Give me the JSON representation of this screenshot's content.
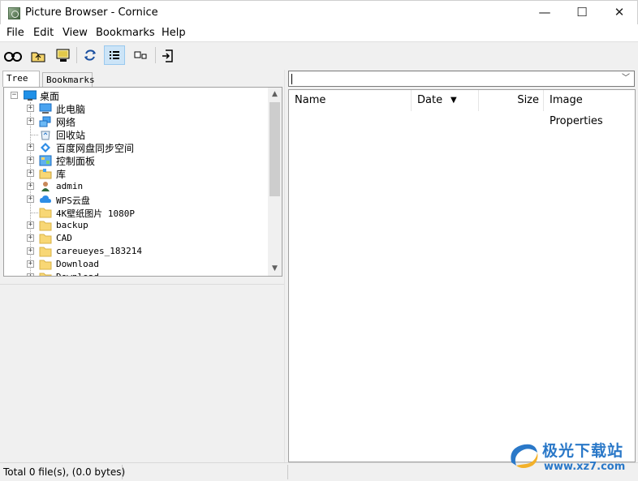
{
  "window": {
    "title": "Picture Browser - Cornice",
    "minimize_glyph": "—",
    "maximize_glyph": "☐",
    "close_glyph": "✕"
  },
  "menu": [
    "File",
    "Edit",
    "View",
    "Bookmarks",
    "Help"
  ],
  "toolbar": {
    "buttons": [
      {
        "icon": "binoculars-icon"
      },
      {
        "icon": "folder-up-icon"
      },
      {
        "icon": "slideshow-monitor-icon"
      },
      {
        "icon": "refresh-icon"
      },
      {
        "icon": "details-view-icon",
        "active": true
      },
      {
        "icon": "thumbnails-view-icon"
      },
      {
        "icon": "exit-icon"
      }
    ]
  },
  "tabs": {
    "tree": "Tree",
    "bookmarks": "Bookmarks"
  },
  "tree": {
    "root": "桌面",
    "items": [
      {
        "label": "此电脑",
        "icon": "computer-icon",
        "expandable": true,
        "mono": false
      },
      {
        "label": "网络",
        "icon": "network-icon",
        "expandable": true,
        "mono": false
      },
      {
        "label": "回收站",
        "icon": "recycle-bin-icon",
        "expandable": false,
        "mono": false
      },
      {
        "label": "百度网盘同步空间",
        "icon": "baidu-sync-icon",
        "expandable": true,
        "mono": false
      },
      {
        "label": "控制面板",
        "icon": "control-panel-icon",
        "expandable": true,
        "mono": false
      },
      {
        "label": "库",
        "icon": "library-folder-icon",
        "expandable": true,
        "mono": false
      },
      {
        "label": "admin",
        "icon": "user-folder-icon",
        "expandable": true,
        "mono": true
      },
      {
        "label": "WPS云盘",
        "icon": "wps-cloud-icon",
        "expandable": true,
        "mono": true
      },
      {
        "label": "4K壁纸图片 1080P",
        "icon": "folder-icon",
        "expandable": false,
        "mono": true
      },
      {
        "label": "backup",
        "icon": "folder-icon",
        "expandable": true,
        "mono": true
      },
      {
        "label": "CAD",
        "icon": "folder-icon",
        "expandable": true,
        "mono": true
      },
      {
        "label": "careueyes_183214",
        "icon": "folder-icon",
        "expandable": true,
        "mono": true
      },
      {
        "label": "Download",
        "icon": "folder-icon",
        "expandable": true,
        "mono": true
      },
      {
        "label": "Download",
        "icon": "folder-icon",
        "expandable": true,
        "mono": true
      }
    ]
  },
  "address": {
    "value": ""
  },
  "filelist": {
    "columns": [
      "Name",
      "Date",
      "Size",
      "Image Properties"
    ],
    "sort_glyph": "▼"
  },
  "status": {
    "text": "Total 0 file(s), (0.0 bytes)"
  },
  "watermark": {
    "text": "极光下载站",
    "url": "www.xz7.com"
  },
  "colors": {
    "accent": "#0078d7",
    "selection": "#cce4f7",
    "folder": "#f8d775"
  }
}
